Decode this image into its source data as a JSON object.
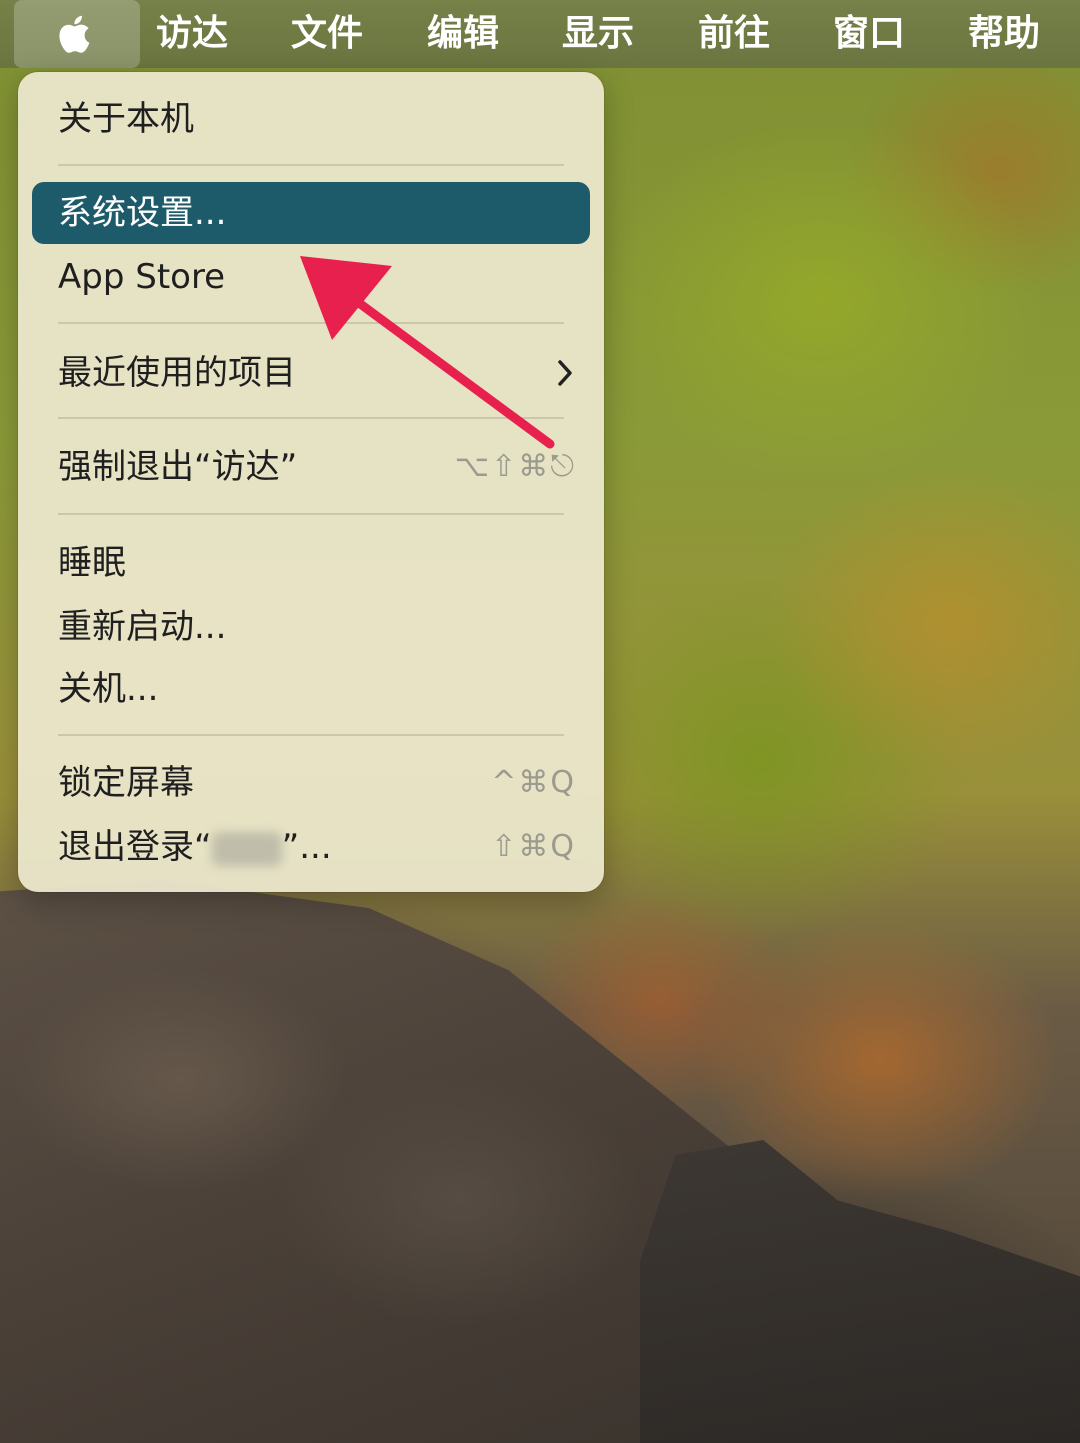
{
  "menubar": {
    "apple_icon": "apple-logo-icon",
    "items": [
      {
        "label": "访达"
      },
      {
        "label": "文件"
      },
      {
        "label": "编辑"
      },
      {
        "label": "显示"
      },
      {
        "label": "前往"
      },
      {
        "label": "窗口"
      },
      {
        "label": "帮助"
      }
    ]
  },
  "apple_menu": {
    "items": [
      {
        "label": "关于本机"
      },
      {
        "label": "系统设置...",
        "selected": true
      },
      {
        "label": "App Store"
      },
      {
        "label": "最近使用的项目",
        "submenu_icon": "chevron-right-icon"
      },
      {
        "label": "强制退出“访达”",
        "shortcut": "⌥⇧⌘⎋"
      },
      {
        "label": "睡眠"
      },
      {
        "label": "重新启动..."
      },
      {
        "label": "关机..."
      },
      {
        "label": "锁定屏幕",
        "shortcut": "^⌘Q"
      },
      {
        "label_prefix": "退出登录“",
        "label_suffix": "”...",
        "shortcut": "⇧⌘Q"
      }
    ]
  },
  "colors": {
    "selection": "#1d5b6b",
    "arrow": "#e8204e",
    "menu_background": "#ece8cd"
  }
}
